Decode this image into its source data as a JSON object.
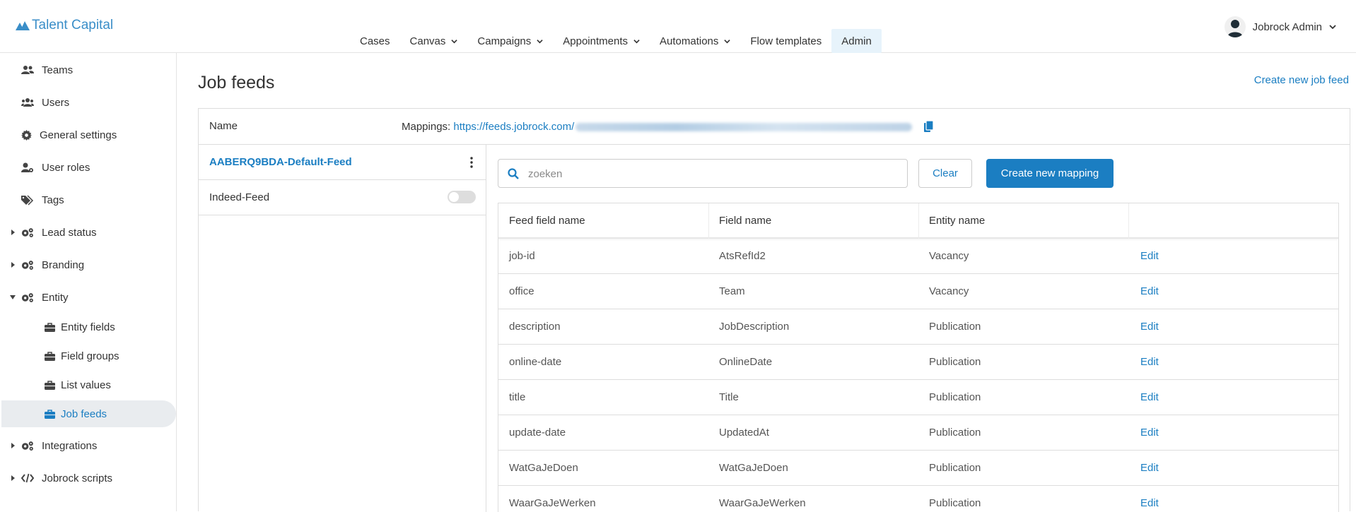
{
  "app": {
    "logo_text": "Talent Capital"
  },
  "nav": {
    "items": [
      {
        "label": "Cases",
        "dropdown": false
      },
      {
        "label": "Canvas",
        "dropdown": true
      },
      {
        "label": "Campaigns",
        "dropdown": true
      },
      {
        "label": "Appointments",
        "dropdown": true
      },
      {
        "label": "Automations",
        "dropdown": true
      },
      {
        "label": "Flow templates",
        "dropdown": false
      },
      {
        "label": "Admin",
        "dropdown": false,
        "active": true
      }
    ]
  },
  "user": {
    "name": "Jobrock Admin"
  },
  "sidebar": {
    "items": [
      {
        "label": "Teams",
        "icon": "users-icon"
      },
      {
        "label": "Users",
        "icon": "users-icon"
      },
      {
        "label": "General settings",
        "icon": "gear-icon"
      },
      {
        "label": "User roles",
        "icon": "user-gear-icon"
      },
      {
        "label": "Tags",
        "icon": "tags-icon"
      },
      {
        "label": "Lead status",
        "icon": "gears-icon",
        "expandable": true
      },
      {
        "label": "Branding",
        "icon": "gears-icon",
        "expandable": true
      },
      {
        "label": "Entity",
        "icon": "gears-icon",
        "expandable": true,
        "expanded": true
      },
      {
        "label": "Entity fields",
        "icon": "briefcase-icon",
        "sub": true
      },
      {
        "label": "Field groups",
        "icon": "briefcase-icon",
        "sub": true
      },
      {
        "label": "List values",
        "icon": "briefcase-icon",
        "sub": true
      },
      {
        "label": "Job feeds",
        "icon": "briefcase-icon",
        "sub": true,
        "active": true
      },
      {
        "label": "Integrations",
        "icon": "gears-icon",
        "expandable": true
      },
      {
        "label": "Jobrock scripts",
        "icon": "code-icon",
        "expandable": true
      }
    ]
  },
  "main": {
    "title": "Job feeds",
    "create_feed_label": "Create new job feed",
    "name_header": "Name",
    "mappings_label": "Mappings:",
    "mappings_url": "https://feeds.jobrock.com/",
    "feeds": [
      {
        "name": "AABERQ9BDA-Default-Feed",
        "selected": true
      },
      {
        "name": "Indeed-Feed",
        "enabled": false
      }
    ],
    "search": {
      "placeholder": "zoeken",
      "value": ""
    },
    "clear_label": "Clear",
    "create_mapping_label": "Create new mapping",
    "table": {
      "columns": [
        "Feed field name",
        "Field name",
        "Entity name",
        ""
      ],
      "rows": [
        {
          "feed_field": "job-id",
          "field": "AtsRefId2",
          "entity": "Vacancy",
          "action": "Edit"
        },
        {
          "feed_field": "office",
          "field": "Team",
          "entity": "Vacancy",
          "action": "Edit"
        },
        {
          "feed_field": "description",
          "field": "JobDescription",
          "entity": "Publication",
          "action": "Edit"
        },
        {
          "feed_field": "online-date",
          "field": "OnlineDate",
          "entity": "Publication",
          "action": "Edit"
        },
        {
          "feed_field": "title",
          "field": "Title",
          "entity": "Publication",
          "action": "Edit"
        },
        {
          "feed_field": "update-date",
          "field": "UpdatedAt",
          "entity": "Publication",
          "action": "Edit"
        },
        {
          "feed_field": "WatGaJeDoen",
          "field": "WatGaJeDoen",
          "entity": "Publication",
          "action": "Edit"
        },
        {
          "feed_field": "WaarGaJeWerken",
          "field": "WaarGaJeWerken",
          "entity": "Publication",
          "action": "Edit"
        }
      ]
    }
  },
  "colors": {
    "accent": "#1b7ec2",
    "logo": "#3a8ec8",
    "active_bg": "#e9ecef",
    "admin_bg": "#e7f3fb"
  }
}
